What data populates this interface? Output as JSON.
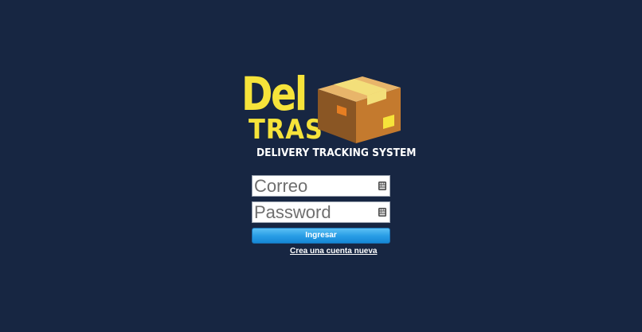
{
  "logo": {
    "word": "Del",
    "sub": "TRAS",
    "tagline": "DELIVERY TRACKING SYSTEM"
  },
  "form": {
    "email_placeholder": "Correo",
    "password_placeholder": "Password",
    "submit_label": "Ingresar",
    "create_account_label": "Crea una cuenta nueva"
  },
  "colors": {
    "background": "#172642",
    "logo_yellow": "#f6e33a",
    "button_blue": "#2a9ee6"
  },
  "icons": {
    "field_icon": "keyboard-icon",
    "logo_icon": "package-box-icon"
  }
}
